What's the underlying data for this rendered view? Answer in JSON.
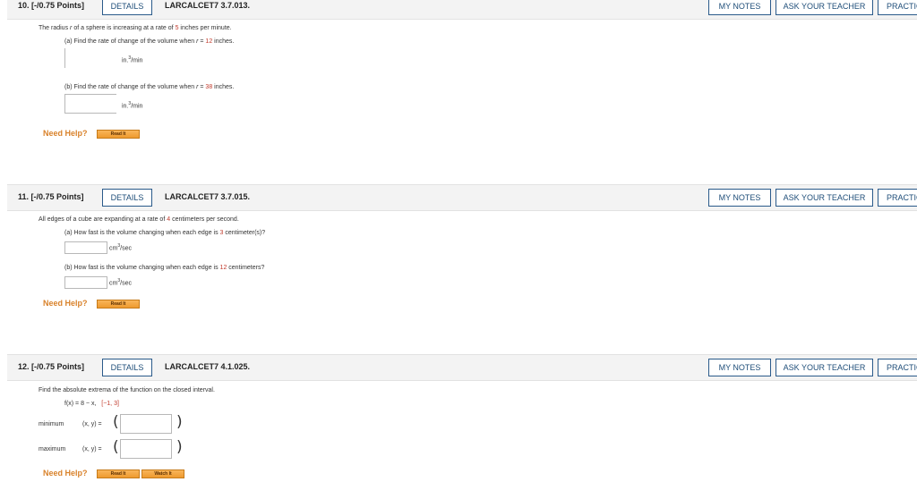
{
  "buttons": {
    "details": "DETAILS",
    "my_notes": "MY NOTES",
    "ask_teacher": "ASK YOUR TEACHER",
    "practice": "PRACTICE ANOTHER"
  },
  "need_help": "Need Help?",
  "read_it": "Read It",
  "watch_it": "Watch It",
  "q10": {
    "number": "10. [-/0.75 Points]",
    "code": "LARCALCET7 3.7.013.",
    "stem_pre": "The radius ",
    "stem_var": "r",
    "stem_mid": " of a sphere is increasing at a rate of ",
    "stem_rate": "5",
    "stem_post": " inches per minute.",
    "a_label": "(a) Find the rate of change of the volume when ",
    "a_var": "r",
    "a_eq": " = ",
    "a_val": "12",
    "a_unit": " inches.",
    "unit_pre": "in.",
    "unit_exp": "3",
    "unit_post": "/min",
    "b_label": "(b) Find the rate of change of the volume when ",
    "b_var": "r",
    "b_eq": " = ",
    "b_val": "38",
    "b_unit": " inches."
  },
  "q11": {
    "number": "11. [-/0.75 Points]",
    "code": "LARCALCET7 3.7.015.",
    "stem_pre": "All edges of a cube are expanding at a rate of ",
    "stem_rate": "4",
    "stem_post": " centimeters per second.",
    "a_label": "(a) How fast is the volume changing when each edge is ",
    "a_val": "3",
    "a_unit": " centimeter(s)?",
    "unit_pre": "cm",
    "unit_exp": "3",
    "unit_post": "/sec",
    "b_label": "(b) How fast is the volume changing when each edge is ",
    "b_val": "12",
    "b_unit": " centimeters?"
  },
  "q12": {
    "number": "12. [-/0.75 Points]",
    "code": "LARCALCET7 4.1.025.",
    "stem": "Find the absolute extrema of the function on the closed interval.",
    "fx": "f(x) = 8 − x,",
    "interval": "[−1, 3]",
    "min_label": "minimum",
    "max_label": "maximum",
    "xy": "(x, y) =",
    "paren_open": "(",
    "paren_close": ")"
  }
}
